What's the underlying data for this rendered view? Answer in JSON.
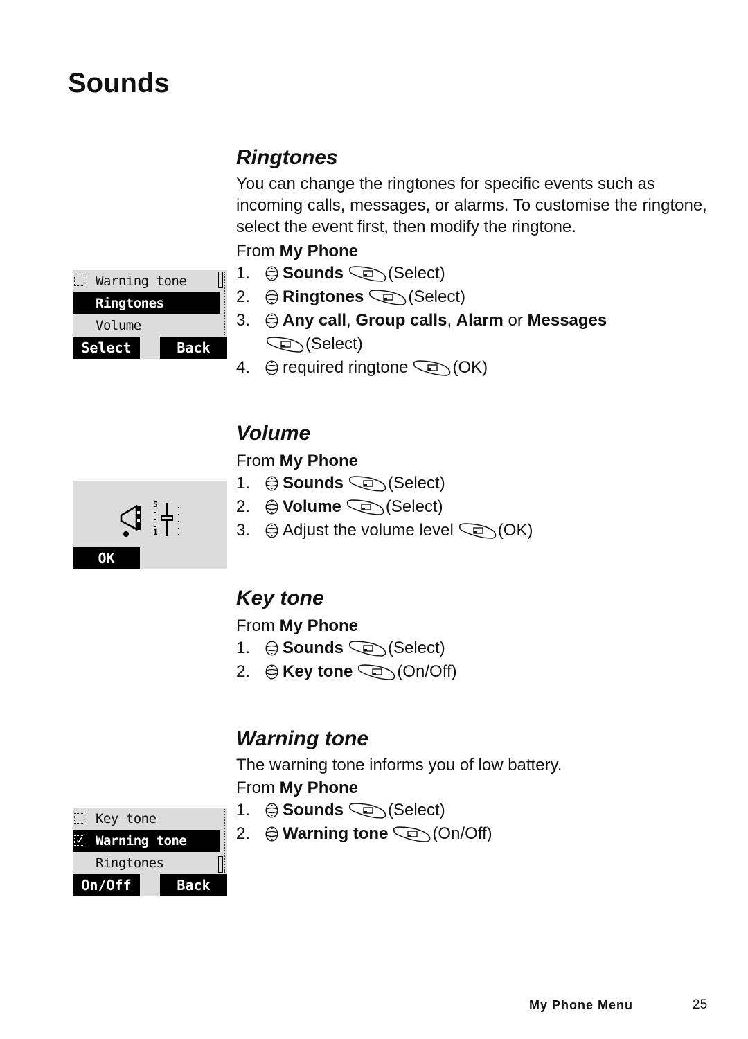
{
  "page": {
    "title": "Sounds",
    "footer_label": "My Phone Menu",
    "page_number": "25"
  },
  "icons": {
    "nav": "navigation-key-icon",
    "select": "select-softkey-icon"
  },
  "sections": {
    "ringtones": {
      "heading": "Ringtones",
      "description": "You can change the ringtones for specific events such as incoming calls, messages, or alarms. To customise the ringtone, select the event first, then modify the ringtone.",
      "from_prefix": "From",
      "from_menu": "My Phone",
      "steps": [
        {
          "num": "1.",
          "bold": "Sounds",
          "action": "(Select)"
        },
        {
          "num": "2.",
          "bold": "Ringtones",
          "action": "(Select)"
        },
        {
          "num": "3.",
          "bold_a": "Any call",
          "sep1": ", ",
          "bold_b": "Group calls",
          "sep2": ", ",
          "bold_c": "Alarm",
          "sep3": " or ",
          "bold_d": "Messages",
          "action": "(Select)"
        },
        {
          "num": "4.",
          "text": "required ringtone",
          "action": "(OK)"
        }
      ],
      "screen": {
        "rows": [
          {
            "label": "Warning tone",
            "checkbox": true,
            "checked": false,
            "highlighted": false
          },
          {
            "label": "Ringtones",
            "highlighted": true
          },
          {
            "label": "Volume",
            "highlighted": false
          }
        ],
        "softkey_left": "Select",
        "softkey_right": "Back"
      }
    },
    "volume": {
      "heading": "Volume",
      "from_prefix": "From",
      "from_menu": "My Phone",
      "steps": [
        {
          "num": "1.",
          "bold": "Sounds",
          "action": "(Select)"
        },
        {
          "num": "2.",
          "bold": "Volume",
          "action": "(Select)"
        },
        {
          "num": "3.",
          "text": "Adjust the volume level",
          "action": "(OK)"
        }
      ],
      "screen": {
        "scale_max": "5",
        "scale_min": "1",
        "level": 3,
        "softkey_left": "OK"
      }
    },
    "keytone": {
      "heading": "Key tone",
      "from_prefix": "From",
      "from_menu": "My Phone",
      "steps": [
        {
          "num": "1.",
          "bold": "Sounds",
          "action": "(Select)"
        },
        {
          "num": "2.",
          "bold": "Key tone",
          "action": "(On/Off)"
        }
      ]
    },
    "warningtone": {
      "heading": "Warning tone",
      "description": "The warning tone informs you of low battery.",
      "from_prefix": "From",
      "from_menu": "My Phone",
      "steps": [
        {
          "num": "1.",
          "bold": "Sounds",
          "action": "(Select)"
        },
        {
          "num": "2.",
          "bold": "Warning tone",
          "action": "(On/Off)"
        }
      ],
      "screen": {
        "rows": [
          {
            "label": "Key tone",
            "checkbox": true,
            "checked": false,
            "highlighted": false
          },
          {
            "label": "Warning tone",
            "checkbox": true,
            "checked": true,
            "highlighted": true
          },
          {
            "label": "Ringtones",
            "highlighted": false
          }
        ],
        "softkey_left": "On/Off",
        "softkey_right": "Back"
      }
    }
  }
}
